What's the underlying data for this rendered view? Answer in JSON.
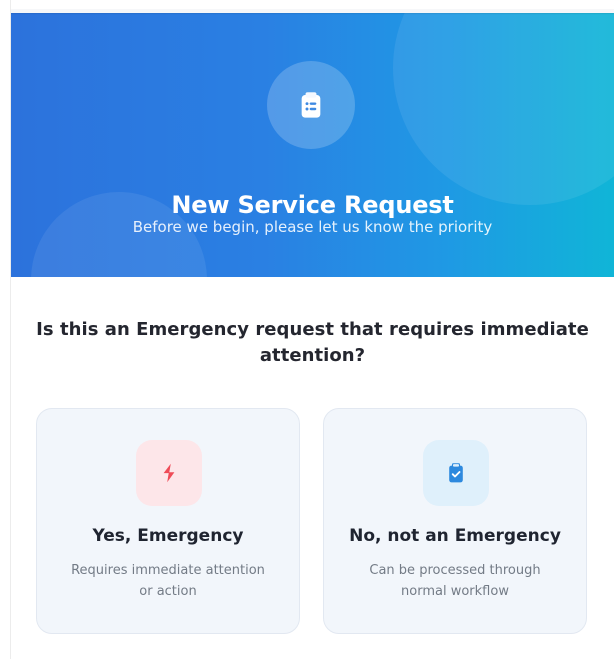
{
  "hero": {
    "title": "New Service Request",
    "subtitle": "Before we begin, please let us know the priority",
    "icon": "clipboard-list-icon",
    "colors": {
      "gradient_start": "#2c72dc",
      "gradient_end": "#10b5d7"
    }
  },
  "prompt": {
    "question": "Is this an Emergency request that requires immediate attention?"
  },
  "options": [
    {
      "title": "Yes, Emergency",
      "description": "Requires immediate attention\nor action",
      "icon": "lightning-bolt-icon",
      "accent_color": "#ef4b57"
    },
    {
      "title": "No, not an Emergency",
      "description": "Can be processed through\nnormal workflow",
      "icon": "clipboard-check-icon",
      "accent_color": "#2d89de"
    }
  ]
}
